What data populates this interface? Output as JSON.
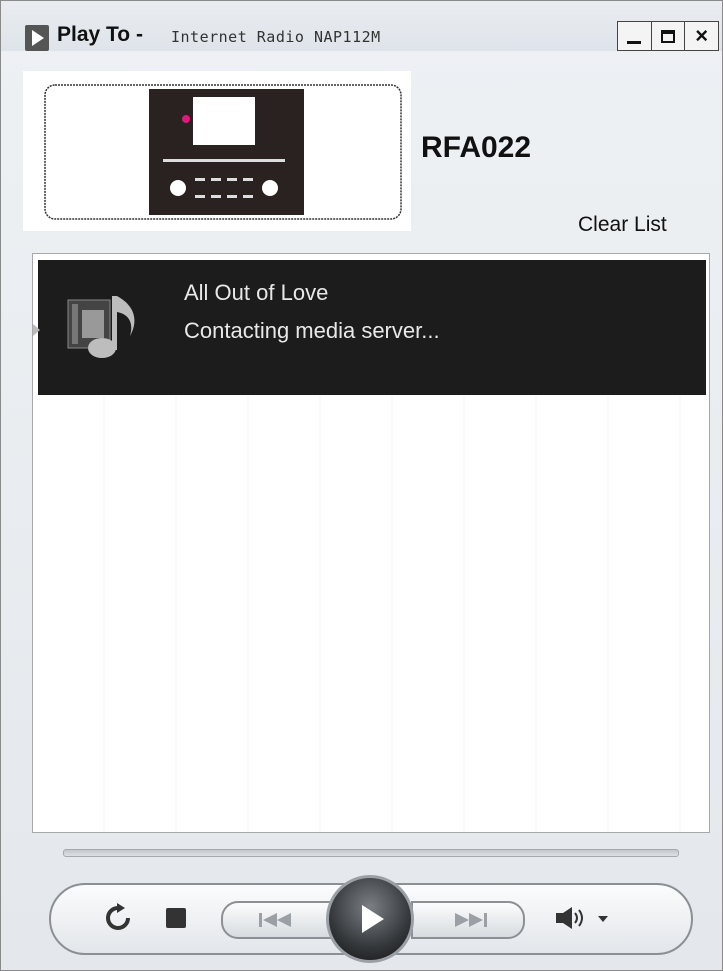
{
  "window": {
    "title": "Play To -",
    "subtitle": "Internet Radio NAP112M"
  },
  "device": {
    "name": "RFA022"
  },
  "clear_list_label": "Clear List",
  "playlist": {
    "items": [
      {
        "title": "All Out of Love",
        "status": "Contacting media server..."
      }
    ]
  },
  "icons": {
    "app": "play-to-icon",
    "media": "music-note-icon",
    "repeat": "repeat-icon",
    "stop": "stop-icon",
    "previous": "previous-icon",
    "play": "play-icon",
    "next": "next-icon",
    "volume": "volume-icon"
  },
  "colors": {
    "now_playing_bg": "#1c1c1c",
    "device_indicator": "#e0187a"
  }
}
